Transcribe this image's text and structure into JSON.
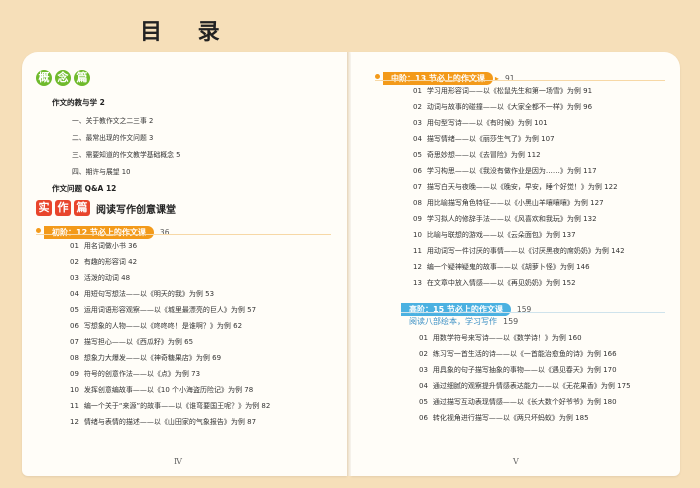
{
  "title": "目  录",
  "left": {
    "section1": {
      "badge": [
        "概",
        "念",
        "篇"
      ],
      "items": [
        {
          "text": "作文的教与学",
          "page": "2"
        },
        {
          "text": "一、关于教作文之二三事",
          "page": "2"
        },
        {
          "text": "二、最常出现的作文问题",
          "page": "3"
        },
        {
          "text": "三、需要知道的作文教学基础概念",
          "page": "5"
        },
        {
          "text": "四、期许与展望",
          "page": "10"
        },
        {
          "text": "作文问题 Q&A",
          "page": "12"
        }
      ]
    },
    "section2": {
      "badge": [
        "实",
        "作",
        "篇"
      ],
      "subtitle": "阅读写作创意课堂",
      "level": {
        "label": "初阶：12 节必上的作文课",
        "page": "36"
      },
      "items": [
        {
          "no": "01",
          "text": "用名词做小书",
          "page": "36"
        },
        {
          "no": "02",
          "text": "有趣的形容词",
          "page": "42"
        },
        {
          "no": "03",
          "text": "活泼的动词",
          "page": "48"
        },
        {
          "no": "04",
          "text": "用短句写想法——以《明天的我》为例",
          "page": "53"
        },
        {
          "no": "05",
          "text": "运用词语形容观察——以《城里最漂亮的巨人》为例",
          "page": "57"
        },
        {
          "no": "06",
          "text": "写想象的人物——以《咚咚咚！是谁啊？》为例",
          "page": "62"
        },
        {
          "no": "07",
          "text": "描写担心——以《西瓜籽》为例",
          "page": "65"
        },
        {
          "no": "08",
          "text": "想象力大爆发——以《神奇糖果店》为例",
          "page": "69"
        },
        {
          "no": "09",
          "text": "符号的创意作法——以《点》为例",
          "page": "73"
        },
        {
          "no": "10",
          "text": "发挥创意编故事——以《10 个小海盗历险记》为例",
          "page": "78"
        },
        {
          "no": "11",
          "text": "编一个关于“来源”的故事——以《谁弯要国王呢？》为例",
          "page": "82"
        },
        {
          "no": "12",
          "text": "情绪与表情的描述——以《山田家的气象报告》为例",
          "page": "87"
        }
      ]
    },
    "page_number": "Ⅳ"
  },
  "right": {
    "mid": {
      "label": "中阶：13 节必上的作文课",
      "page": "91",
      "items": [
        {
          "no": "01",
          "text": "学习用形容词——以《松鼠先生和第一场雪》为例",
          "page": "91"
        },
        {
          "no": "02",
          "text": "动词与故事的碰撞——以《大家全都不一样》为例",
          "page": "96"
        },
        {
          "no": "03",
          "text": "用句型写诗——以《有时候》为例",
          "page": "101"
        },
        {
          "no": "04",
          "text": "描写情绪——以《丽莎生气了》为例",
          "page": "107"
        },
        {
          "no": "05",
          "text": "奇思妙想——以《去冒险》为例",
          "page": "112"
        },
        {
          "no": "06",
          "text": "学习构思——以《我没有做作业是因为……》为例",
          "page": "117"
        },
        {
          "no": "07",
          "text": "描写白天与夜晚——以《晚安，早安，睡个好觉！》为例",
          "page": "122"
        },
        {
          "no": "08",
          "text": "用比喻描写角色特征——以《小黑山羊嚷嚷嚷》为例",
          "page": "127"
        },
        {
          "no": "09",
          "text": "学习拟人的修辞手法——以《风喜欢和我玩》为例",
          "page": "132"
        },
        {
          "no": "10",
          "text": "比喻与联想的游戏——以《云朵面包》为例",
          "page": "137"
        },
        {
          "no": "11",
          "text": "用动词写一件讨厌的事情——以《讨厌黑夜的席奶奶》为例",
          "page": "142"
        },
        {
          "no": "12",
          "text": "编一个疑神疑鬼的故事——以《胡萝卜怪》为例",
          "page": "146"
        },
        {
          "no": "13",
          "text": "在文章中放入情感——以《再见奶奶》为例",
          "page": "152"
        }
      ]
    },
    "high": {
      "label": "高阶：15 节必上的作文课",
      "page": "159",
      "guide": {
        "text": "阅读八部绘本，学习写作",
        "page": "159"
      },
      "items": [
        {
          "no": "01",
          "text": "用数学符号来写诗——以《数学诗！》为例",
          "page": "160"
        },
        {
          "no": "02",
          "text": "练习写一首生活的诗——以《一首能治愈鱼的诗》为例",
          "page": "166"
        },
        {
          "no": "03",
          "text": "用具象的句子描写抽象的事物——以《遇见春天》为例",
          "page": "170"
        },
        {
          "no": "04",
          "text": "通过细腻的观察提升情感表达能力——以《无花果香》为例",
          "page": "175"
        },
        {
          "no": "05",
          "text": "通过描写互动表现情感——以《长大数个好爷爷》为例",
          "page": "180"
        },
        {
          "no": "06",
          "text": "转化视角进行描写——以《两只坏蚂蚁》为例",
          "page": "185"
        }
      ]
    },
    "page_number": "Ⅴ"
  },
  "colors": {
    "accent_orange": "#f39a1a",
    "accent_blue": "#4bb1e1",
    "badge_green": "#6fba2c",
    "badge_red": "#e8452c",
    "background": "#f6dfb9"
  }
}
